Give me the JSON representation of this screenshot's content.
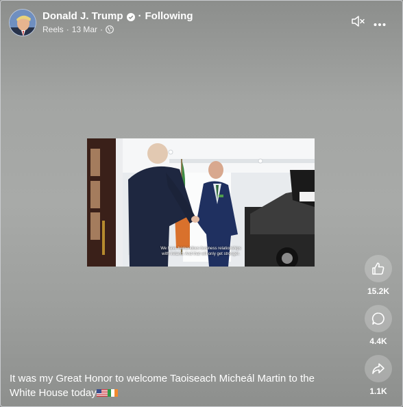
{
  "post": {
    "author": "Donald J. Trump",
    "follow_separator": "·",
    "follow_state": "Following",
    "source": "Reels",
    "meta_separator": "·",
    "date": "13 Mar",
    "meta_separator_2": "·"
  },
  "video": {
    "subtitle_line1": "We have tremendous business relationships",
    "subtitle_line2": "with Ireland. And that will only get stronger."
  },
  "actions": {
    "like_count": "15.2K",
    "comment_count": "4.4K",
    "share_count": "1.1K"
  },
  "caption": {
    "text": "It was my Great Honor to welcome Taoiseach Micheál Martin to the White House today"
  },
  "icons": {
    "verified": "verified-badge-icon",
    "privacy": "globe-icon",
    "mute": "speaker-muted-icon",
    "more": "more-horizontal-icon",
    "like": "thumbs-up-icon",
    "comment": "comment-bubble-icon",
    "share": "share-arrow-icon",
    "flags": [
      "us-flag-icon",
      "ireland-flag-icon"
    ]
  },
  "colors": {
    "background": "#a3a5a3",
    "text": "#ffffff",
    "action_circle": "rgba(255,255,255,0.22)"
  }
}
